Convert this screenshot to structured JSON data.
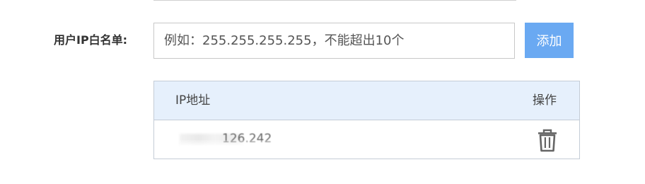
{
  "whitelist": {
    "label": "用户IP白名单:",
    "input_placeholder": "例如：255.255.255.255，不能超出10个",
    "input_value": "",
    "add_button_label": "添加",
    "accent_color": "#6aa9f2"
  },
  "table": {
    "headers": {
      "ip": "IP地址",
      "actions": "操作"
    },
    "rows": [
      {
        "ip": "126.242",
        "action_icon": "trash-icon"
      }
    ],
    "header_bg": "#e6f0fc"
  }
}
